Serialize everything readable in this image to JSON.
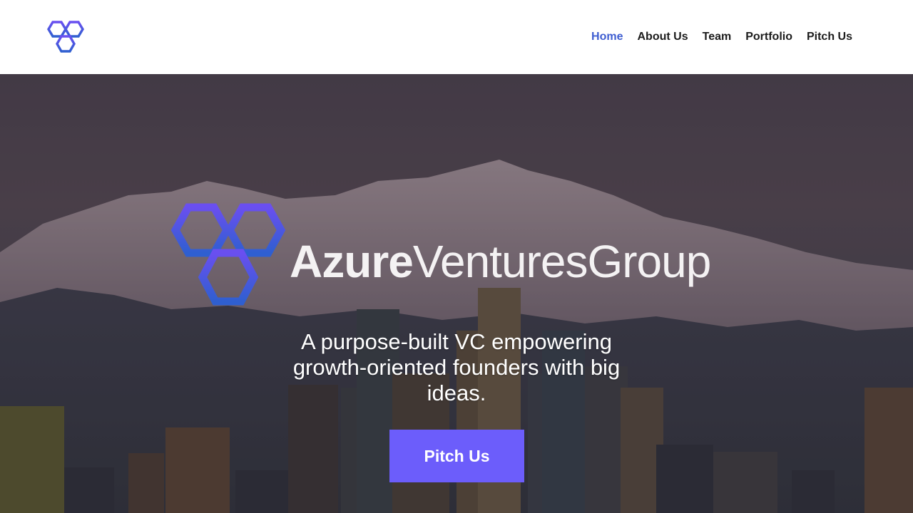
{
  "header": {
    "nav": [
      {
        "label": "Home",
        "active": true
      },
      {
        "label": "About Us",
        "active": false
      },
      {
        "label": "Team",
        "active": false
      },
      {
        "label": "Portfolio",
        "active": false
      },
      {
        "label": "Pitch Us",
        "active": false
      }
    ],
    "logo_icon": "hexagon-cluster-icon"
  },
  "hero": {
    "brand_bold": "Azure",
    "brand_light": "VenturesGroup",
    "tagline": "A purpose-built VC empowering growth-oriented founders with big ideas.",
    "cta_label": "Pitch Us"
  },
  "colors": {
    "accent": "#6c5dfb",
    "nav_active": "#3f5ed1",
    "logo_gradient_start": "#6a4ff0",
    "logo_gradient_end": "#2f5fd0"
  }
}
